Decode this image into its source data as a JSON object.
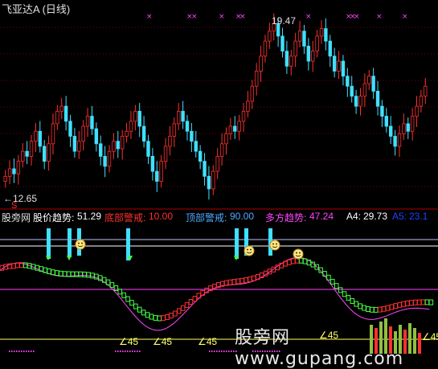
{
  "title": "飞亚达A (日线)",
  "price_high_label": "19.47",
  "price_low_label": "←12.65",
  "signal_mark": "S",
  "indicator": {
    "name": "股旁网",
    "items": [
      {
        "label": "股价趋势:",
        "value": "51.29",
        "color": "#ffffff"
      },
      {
        "label": "底部警戒:",
        "value": "10.00",
        "color": "#ff3030"
      },
      {
        "label": "顶部警戒:",
        "value": "90.00",
        "color": "#4fa8ff"
      },
      {
        "label": "多方趋势:",
        "value": "47.24",
        "color": "#ff44ff"
      },
      {
        "label": "A4:",
        "value": "29.73",
        "color": "#ffffff"
      },
      {
        "label": "A5:",
        "value": "23.1",
        "color": "#2040ff"
      }
    ]
  },
  "angle_labels": [
    "∠45",
    "∠45",
    "∠45",
    "∠45",
    "∠45"
  ],
  "watermark": "股旁网 www.gupang.com",
  "colors": {
    "up": "#ff3030",
    "down": "#40e0ff",
    "highlight": "#40e0ff",
    "magenta": "#ff44ff",
    "green": "#44ff44",
    "yellow": "#ffff66"
  }
}
